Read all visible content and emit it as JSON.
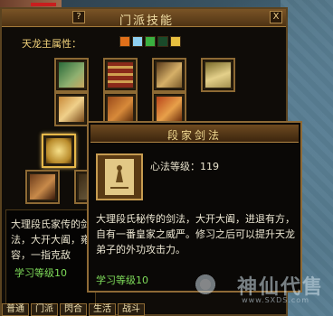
{
  "window": {
    "title": "门派技能",
    "help_btn": "?",
    "close_btn": "X",
    "attr_label": "天龙主属性："
  },
  "elements": [
    {
      "icon": "fire-icon",
      "color": "#e0701a"
    },
    {
      "icon": "ice-icon",
      "color": "#8fd0f0"
    },
    {
      "icon": "poison-icon",
      "color": "#3ab040"
    },
    {
      "icon": "mystic-icon",
      "color": "#1a4a2a"
    },
    {
      "icon": "yang-icon",
      "color": "#e8c040"
    }
  ],
  "skills": [
    {
      "name": "scroll-green"
    },
    {
      "name": "scroll-bundle"
    },
    {
      "name": "scroll-gold"
    },
    {
      "name": "scroll-yellow"
    },
    {
      "name": "scroll-swordsman"
    },
    {
      "name": "scroll-red-book"
    },
    {
      "name": "scroll-fire"
    },
    {
      "name": "scroll-bookcase"
    },
    {
      "name": "scroll-selected"
    },
    {
      "name": "scroll-bottom"
    }
  ],
  "description": {
    "text": "大理段氏家传的剑法，大开大阖，雍容，一指克敌",
    "level": "学习等级10"
  },
  "tooltip": {
    "title": "段家剑法",
    "level_label": "心法等级：119",
    "desc": "大理段氏秘传的剑法，大开大阖，进退有方，自有一番皇家之威严。修习之后可以提升天龙弟子的外功攻击力。",
    "learn": "学习等级10"
  },
  "tabs": [
    "普通",
    "门派",
    "閃合",
    "生活",
    "战斗"
  ],
  "watermark": {
    "text": "神仙代售",
    "url": "www.SXDS.com"
  },
  "accent": "#8d6a34"
}
